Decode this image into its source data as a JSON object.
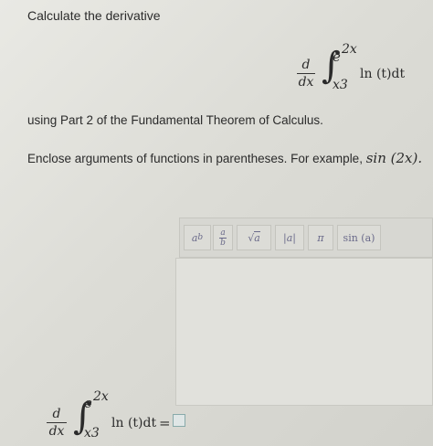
{
  "question": {
    "prompt": "Calculate the derivative",
    "sentence": "using Part 2 of the Fundamental Theorem of Calculus.",
    "instruction": "Enclose arguments of functions in parentheses. For example,",
    "example": "sin (2x).",
    "math": {
      "d": "d",
      "dx": "dx",
      "integral": "∫",
      "upper_base": "e",
      "upper_exp": "2x",
      "lower": "x3",
      "integrand": "ln (t)dt"
    }
  },
  "toolbar": {
    "power_base": "a",
    "power_exp": "b",
    "frac_num": "a",
    "frac_den": "b",
    "sqrt_symbol": "√",
    "sqrt_arg": "a",
    "abs_label": "|a|",
    "pi_label": "π",
    "sin_label": "sin (a)"
  },
  "answer": {
    "d": "d",
    "dx": "dx",
    "integral": "∫",
    "upper_base": "e",
    "upper_exp": "2x",
    "lower": "x3",
    "integrand": "ln (t)dt",
    "equals": "="
  }
}
